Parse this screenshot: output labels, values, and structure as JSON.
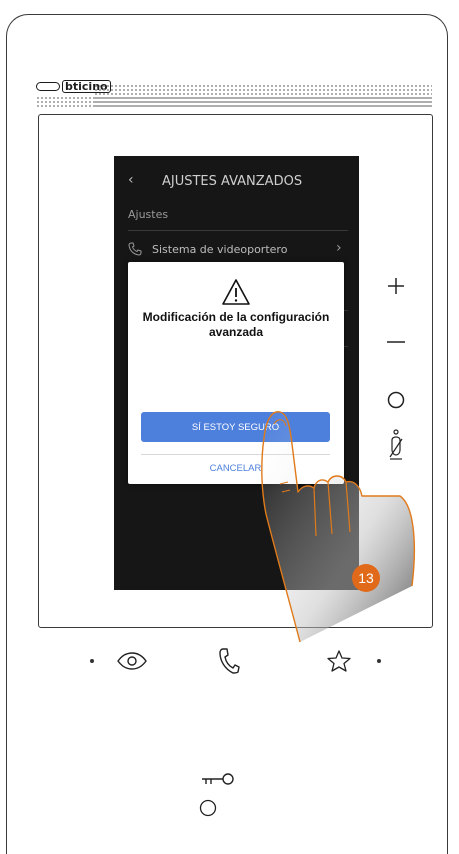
{
  "brand": {
    "logo_text": "bticino"
  },
  "screen": {
    "title": "AJUSTES AVANZADOS",
    "section_label": "Ajustes",
    "menu_item": "Sistema de videoportero"
  },
  "dialog": {
    "title": "Modificación de la configuración avanzada",
    "confirm_label": "SÍ ESTOY SEGURO",
    "cancel_label": "CANCELAR"
  },
  "side_controls": {
    "plus_label": "+"
  },
  "step_badge": "13",
  "colors": {
    "accent": "#4d7fdc",
    "badge": "#e06a1a",
    "finger_outline": "#e07a1a",
    "screen_bg": "#161616"
  },
  "icons": {
    "back": "chevron-left-icon",
    "warning": "warning-triangle-icon",
    "phone": "phone-icon",
    "plus": "plus-icon",
    "minus": "minus-icon",
    "home": "circle-icon",
    "mute": "mic-off-icon",
    "eye": "eye-icon",
    "handset": "handset-icon",
    "star": "star-icon",
    "key": "key-icon"
  }
}
